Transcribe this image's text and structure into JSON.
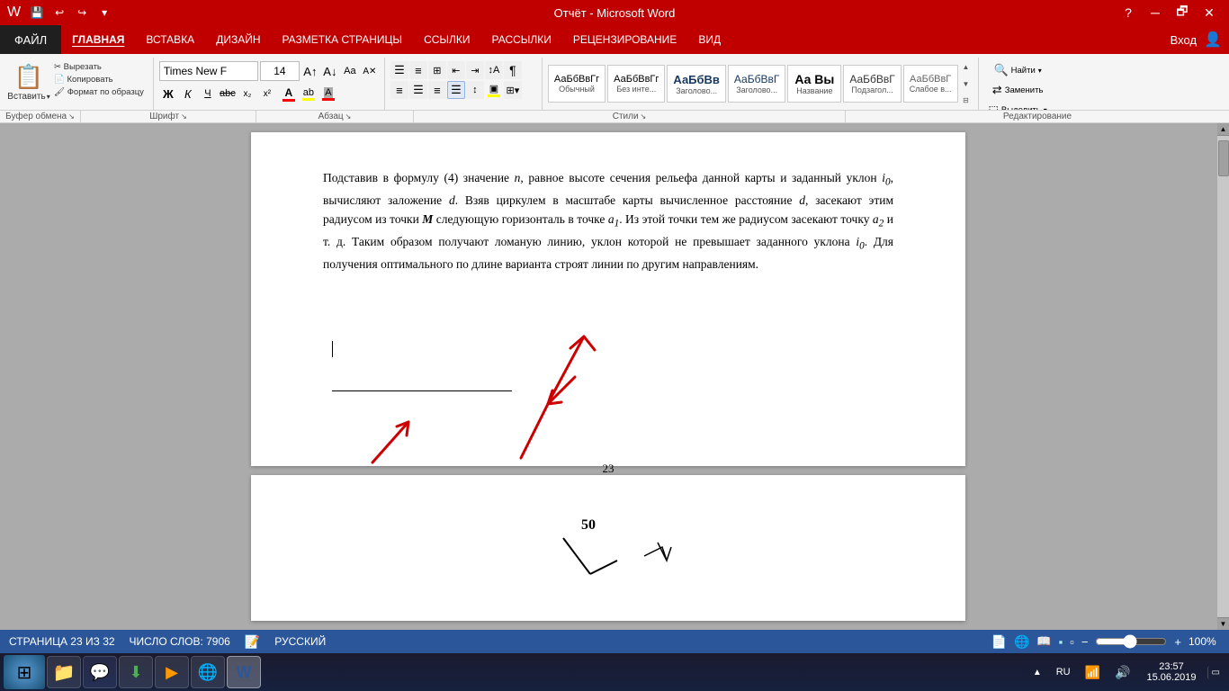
{
  "titlebar": {
    "title": "Отчёт - Microsoft Word",
    "quick_access": [
      "💾",
      "↩",
      "↪"
    ],
    "controls": [
      "?",
      "🗖",
      "─",
      "🗗",
      "✕"
    ]
  },
  "menubar": {
    "file": "ФАЙЛ",
    "items": [
      "ГЛАВНАЯ",
      "ВСТАВКА",
      "ДИЗАЙН",
      "РАЗМЕТКА СТРАНИЦЫ",
      "ССЫЛКИ",
      "РАССЫЛКИ",
      "РЕЦЕНЗИРОВАНИЕ",
      "ВИД"
    ],
    "signin": "Вход"
  },
  "ribbon": {
    "clipboard": {
      "label": "Буфер обмена",
      "paste": "Вставить",
      "cut": "Вырезать",
      "copy": "Копировать",
      "format": "Формат по образцу"
    },
    "font": {
      "label": "Шрифт",
      "name": "Times New F",
      "size": "14",
      "bold": "Ж",
      "italic": "К",
      "underline": "Ч",
      "strikethrough": "abc",
      "subscript": "x₂",
      "superscript": "x²"
    },
    "paragraph": {
      "label": "Абзац"
    },
    "styles": {
      "label": "Стили",
      "items": [
        {
          "label": "АаБбВвГг",
          "name": "Обычный"
        },
        {
          "label": "АаБбВвГг",
          "name": "Без инте..."
        },
        {
          "label": "АаБбВв",
          "name": "Заголово..."
        },
        {
          "label": "АаБбВвГ",
          "name": "Заголово..."
        },
        {
          "label": "Аа Вы",
          "name": "Название"
        },
        {
          "label": "АаБбВвГ",
          "name": "Подзагол..."
        },
        {
          "label": "Слабое в...",
          "name": "Слабое в..."
        }
      ]
    },
    "editing": {
      "label": "Редактирование",
      "find": "Найти",
      "replace": "Заменить",
      "select": "Выделить"
    }
  },
  "document": {
    "page23": {
      "text": "Подставив в формулу (4) значение n, равное высоте сечения рельефа данной карты и заданный уклон i₀, вычисляют заложение d. Взяв циркулем в масштабе карты вычисленное расстояние d, засекают этим радиусом из точки M следующую горизонталь в точке a₁. Из этой точки тем же радиусом засекают точку a₂ и т. д. Таким образом получают ломаную линию, уклон которой не превышает заданного уклона i₀. Для получения оптимального по длине варианта строят линии по другим направлениям.",
      "page_number": "23"
    },
    "page24": {
      "figure_label": "50"
    }
  },
  "statusbar": {
    "page_info": "СТРАНИЦА 23 ИЗ 32",
    "word_count": "ЧИСЛО СЛОВ: 7906",
    "language": "РУССКИЙ",
    "zoom": "100%",
    "zoom_value": 100
  },
  "taskbar": {
    "items": [
      {
        "icon": "⊞",
        "name": "start",
        "type": "start"
      },
      {
        "icon": "📁",
        "name": "explorer"
      },
      {
        "icon": "💬",
        "name": "discord"
      },
      {
        "icon": "⬇",
        "name": "downloader"
      },
      {
        "icon": "▶",
        "name": "media"
      },
      {
        "icon": "🌐",
        "name": "chrome"
      },
      {
        "icon": "W",
        "name": "word",
        "active": true
      }
    ],
    "tray": {
      "language": "RU",
      "time": "23:57",
      "date": "15.06.2019"
    }
  }
}
